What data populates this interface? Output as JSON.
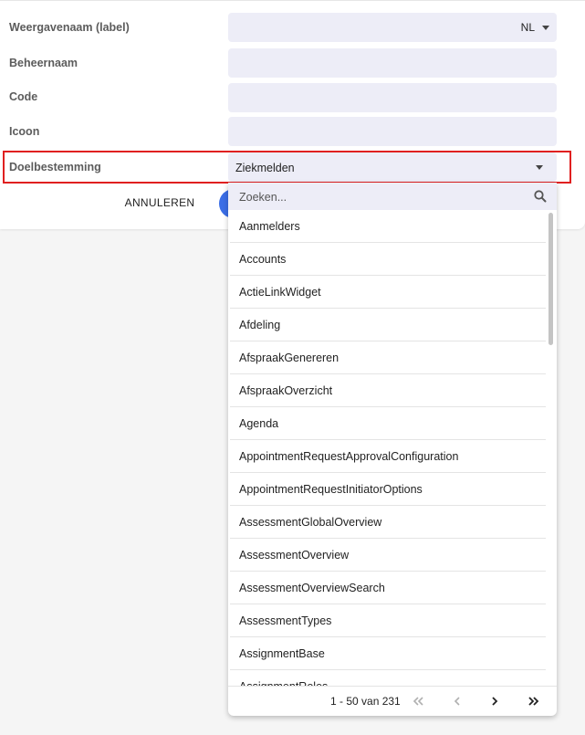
{
  "form": {
    "display_name_label": "Weergavenaam (label)",
    "language": "NL",
    "admin_name_label": "Beheernaam",
    "code_label": "Code",
    "icon_label": "Icoon",
    "target_label": "Doelbestemming",
    "target_value": "Ziekmelden",
    "cancel_label": "ANNULEREN"
  },
  "dropdown": {
    "search_placeholder": "Zoeken...",
    "items": [
      "Aanmelders",
      "Accounts",
      "ActieLinkWidget",
      "Afdeling",
      "AfspraakGenereren",
      "AfspraakOverzicht",
      "Agenda",
      "AppointmentRequestApprovalConfiguration",
      "AppointmentRequestInitiatorOptions",
      "AssessmentGlobalOverview",
      "AssessmentOverview",
      "AssessmentOverviewSearch",
      "AssessmentTypes",
      "AssignmentBase",
      "AssignmentRoles"
    ],
    "pagination": {
      "range": "1 - 50 van 231"
    }
  },
  "colors": {
    "field_bg": "#ededf7",
    "highlight": "#e02020",
    "primary": "#3b6ee6"
  }
}
